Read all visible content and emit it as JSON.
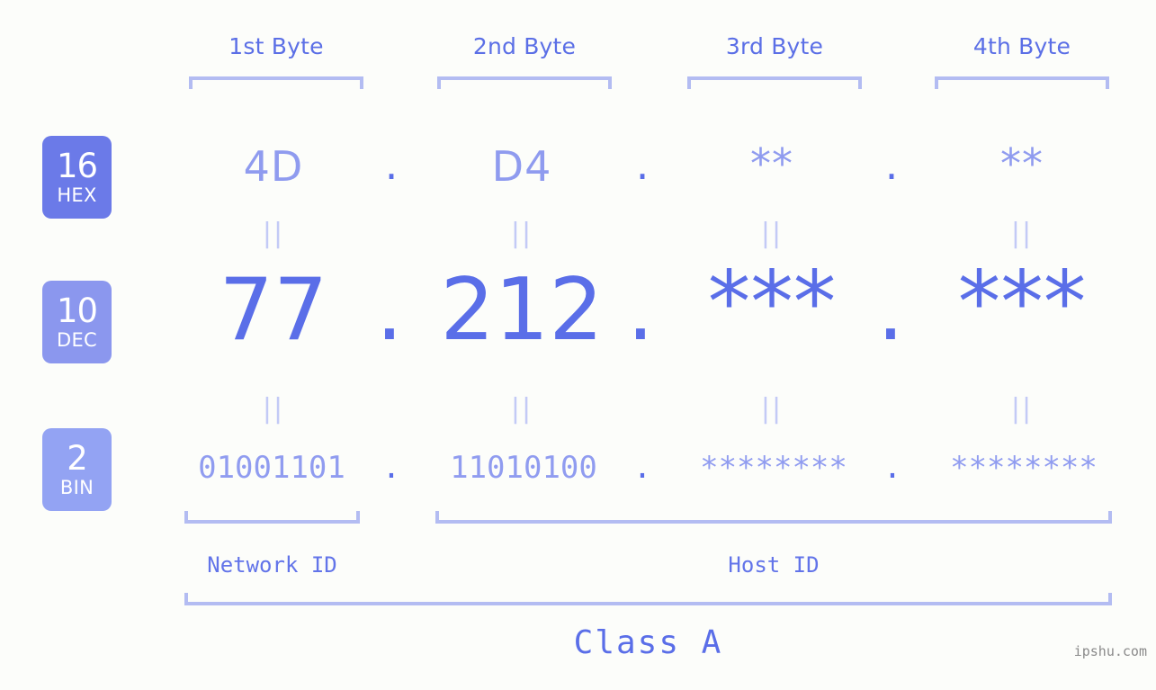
{
  "background_color": "#fcfdfa",
  "accent_colors": {
    "strong_blue": "#5a6ee8",
    "mid_blue": "#8f9bef",
    "light_lavender": "#b3bcf2",
    "faint_lavender": "#c3caf6",
    "badge_hex": "#6b7ae8",
    "badge_dec": "#8b97ee",
    "badge_bin": "#93a3f3",
    "watermark_gray": "#8a8a8a"
  },
  "byte_headers": [
    {
      "label": "1st Byte"
    },
    {
      "label": "2nd Byte"
    },
    {
      "label": "3rd Byte"
    },
    {
      "label": "4th Byte"
    }
  ],
  "bases": [
    {
      "number": "16",
      "name": "HEX"
    },
    {
      "number": "10",
      "name": "DEC"
    },
    {
      "number": "2",
      "name": "BIN"
    }
  ],
  "rows": {
    "hex": {
      "base_number": "16",
      "base_name": "HEX",
      "values": [
        "4D",
        "D4",
        "**",
        "**"
      ],
      "separator": "."
    },
    "dec": {
      "base_number": "10",
      "base_name": "DEC",
      "values": [
        "77",
        "212",
        "***",
        "***"
      ],
      "separator": "."
    },
    "bin": {
      "base_number": "2",
      "base_name": "BIN",
      "values": [
        "01001101",
        "11010100",
        "********",
        "********"
      ],
      "separator": "."
    }
  },
  "equals_marks": {
    "glyph": "||",
    "count_per_row": 4
  },
  "segments": [
    {
      "label": "Network ID"
    },
    {
      "label": "Host ID"
    }
  ],
  "class": {
    "label": "Class A"
  },
  "watermark": {
    "text": "ipshu.com"
  }
}
